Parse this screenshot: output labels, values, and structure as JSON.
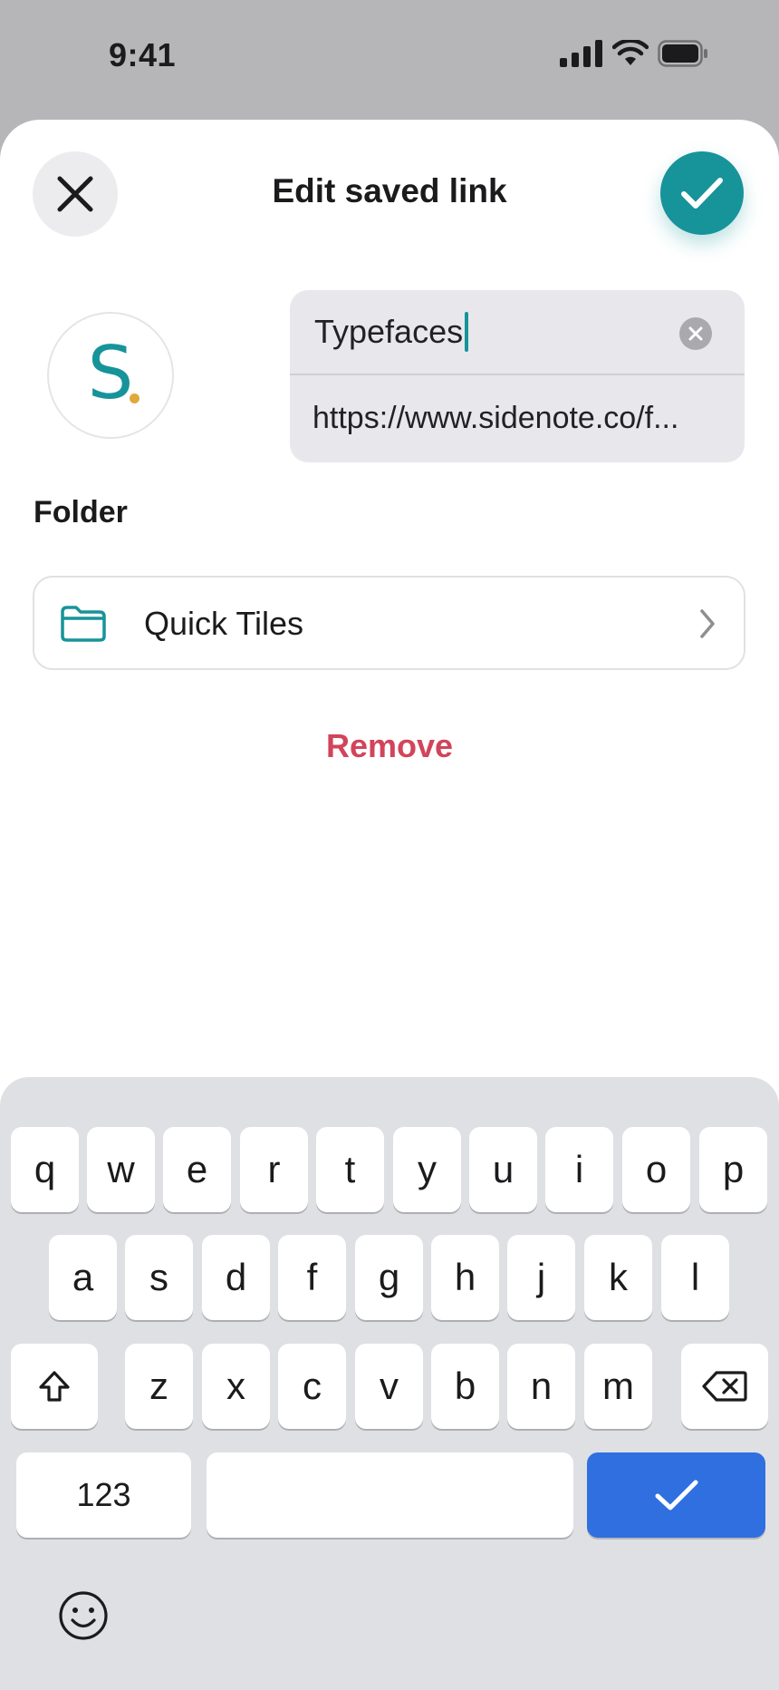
{
  "status_bar": {
    "time": "9:41",
    "icons": [
      "cellular-signal-icon",
      "wifi-icon",
      "battery-icon"
    ]
  },
  "sheet": {
    "title": "Edit saved link",
    "close_icon": "close-icon",
    "confirm_icon": "checkmark-icon"
  },
  "site": {
    "favicon_letter": "S"
  },
  "fields": {
    "title_value": "Typefaces",
    "url_value": "https://www.sidenote.co/f..."
  },
  "folder": {
    "label": "Folder",
    "selected": "Quick Tiles"
  },
  "actions": {
    "remove_label": "Remove"
  },
  "keyboard": {
    "row1": [
      "q",
      "w",
      "e",
      "r",
      "t",
      "y",
      "u",
      "i",
      "o",
      "p"
    ],
    "row2": [
      "a",
      "s",
      "d",
      "f",
      "g",
      "h",
      "j",
      "k",
      "l"
    ],
    "row3": [
      "z",
      "x",
      "c",
      "v",
      "b",
      "n",
      "m"
    ],
    "numbers_label": "123"
  },
  "colors": {
    "accent": "#17939a",
    "destructive": "#d2445a",
    "keyboard_return": "#2f6fe0",
    "favicon_dot": "#e0a93b"
  }
}
